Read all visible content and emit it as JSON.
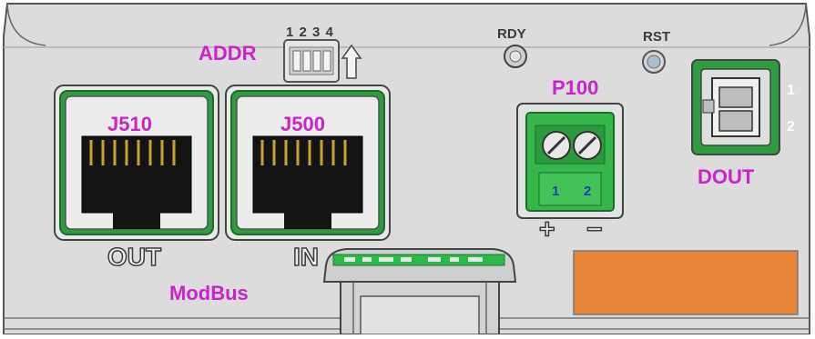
{
  "labels": {
    "addr": "ADDR",
    "dip_numbers": "1 2 3 4",
    "rdy": "RDY",
    "rst": "RST",
    "p100": "P100",
    "j510": "J510",
    "j500": "J500",
    "out": "OUT",
    "in": "IN",
    "modbus": "ModBus",
    "dout": "DOUT",
    "dout_pin1": "1",
    "dout_pin2": "2",
    "terminal_pin1": "1",
    "terminal_pin2": "2",
    "plus": "+",
    "minus": "−"
  },
  "colors": {
    "panel": "#dcdcdc",
    "label_magenta": "#cc22cc",
    "connector_green": "#2db84a",
    "orange_block": "#e8833a"
  }
}
